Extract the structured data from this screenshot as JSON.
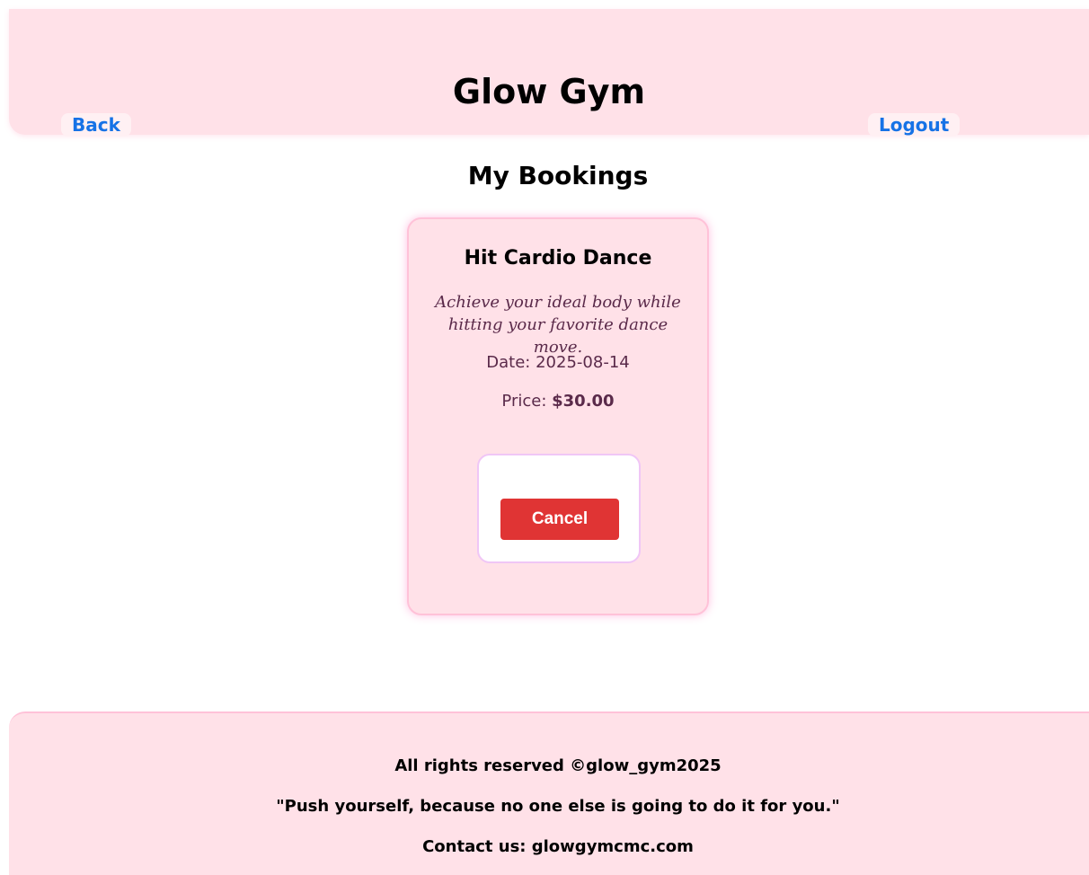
{
  "header": {
    "title": "Glow Gym",
    "back_label": "Back",
    "logout_label": "Logout"
  },
  "main": {
    "heading": "My Bookings",
    "bookings": [
      {
        "title": "Hit Cardio Dance",
        "description": "Achieve your ideal body while hitting your favorite dance move.",
        "date_label": "Date:",
        "date": "2025-08-14",
        "price_label": "Price:",
        "price": "$30.00",
        "cancel_label": "Cancel"
      }
    ]
  },
  "footer": {
    "rights": "All rights reserved ©glow_gym2025",
    "quote": "\"Push yourself, because no one else is going to do it for you.\"",
    "contact": "Contact us: glowgymcmc.com"
  },
  "colors": {
    "header_bg": "#ffe1e8",
    "link": "#1672e6",
    "cancel_button": "#e03434",
    "card_text": "#5a2a4a"
  }
}
